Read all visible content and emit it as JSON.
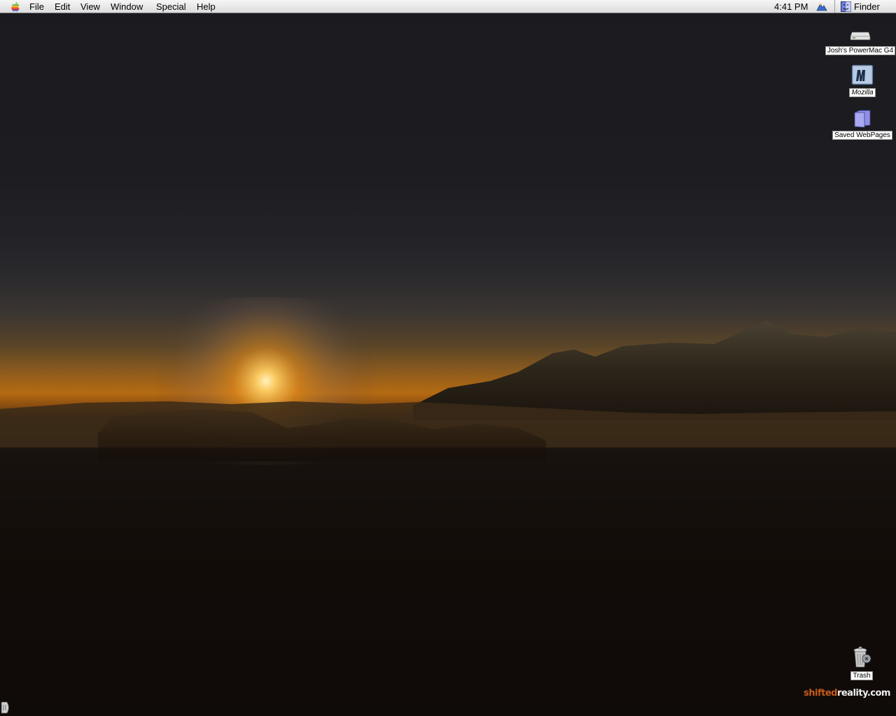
{
  "menubar": {
    "apple_icon": "apple-logo-icon",
    "items": [
      "File",
      "Edit",
      "View",
      "Window",
      "Special",
      "Help"
    ],
    "clock": "4:41 PM",
    "app_name": "Finder",
    "app_icon": "finder-icon",
    "control_icon": "control-strip-icon"
  },
  "desktop": {
    "icons": [
      {
        "label": "Josh's PowerMac G4",
        "icon": "hard-drive-icon"
      },
      {
        "label": "Mozilla",
        "icon": "mozilla-app-icon"
      },
      {
        "label": "Saved WebPages",
        "icon": "folder-icon"
      },
      {
        "label": "Trash",
        "icon": "trash-icon"
      }
    ],
    "watermark": {
      "part1": "shifted",
      "part2": "reality.com"
    }
  },
  "colors": {
    "menubar_bg": "#e6e6e6",
    "sky_dark": "#1b1b1f",
    "sun_glow": "#f2a531",
    "watermark_orange": "#c85a1c"
  }
}
